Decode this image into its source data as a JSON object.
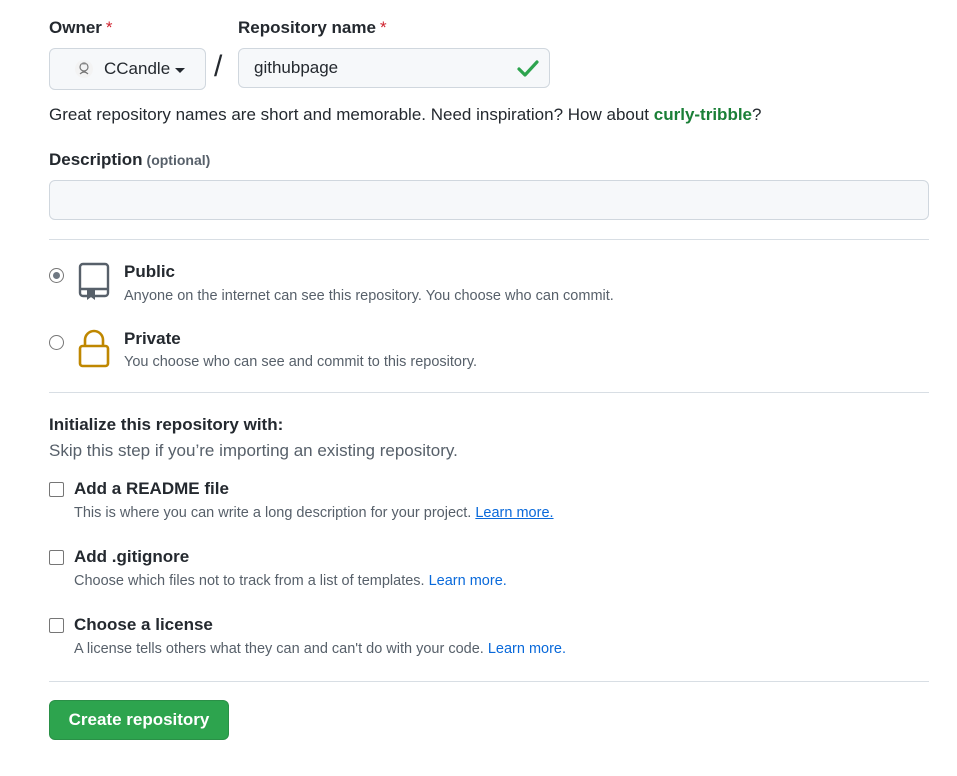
{
  "owner": {
    "label": "Owner",
    "required_mark": "*",
    "value": "CCandle"
  },
  "repo": {
    "label": "Repository name",
    "required_mark": "*",
    "value": "githubpage"
  },
  "slash": "/",
  "hint": {
    "text": "Great repository names are short and memorable. Need inspiration? How about ",
    "suggestion": "curly-tribble",
    "end": "?"
  },
  "description": {
    "label": "Description",
    "optional": "(optional)",
    "value": "",
    "placeholder": ""
  },
  "visibility": {
    "public": {
      "title": "Public",
      "desc": "Anyone on the internet can see this repository. You choose who can commit.",
      "selected": true
    },
    "private": {
      "title": "Private",
      "desc": "You choose who can see and commit to this repository.",
      "selected": false
    }
  },
  "init": {
    "title": "Initialize this repository with:",
    "subtitle": "Skip this step if you’re importing an existing repository.",
    "readme": {
      "title": "Add a README file",
      "desc": "This is where you can write a long description for your project.",
      "link": "Learn more."
    },
    "gitignore": {
      "title": "Add .gitignore",
      "desc": "Choose which files not to track from a list of templates.",
      "link": "Learn more."
    },
    "license": {
      "title": "Choose a license",
      "desc": "A license tells others what they can and can't do with your code.",
      "link": "Learn more."
    }
  },
  "submit": {
    "label": "Create repository"
  },
  "colors": {
    "accent_green": "#2da44e",
    "link_blue": "#0969da",
    "required_red": "#cf222e",
    "lock_gold": "#bf8700"
  }
}
